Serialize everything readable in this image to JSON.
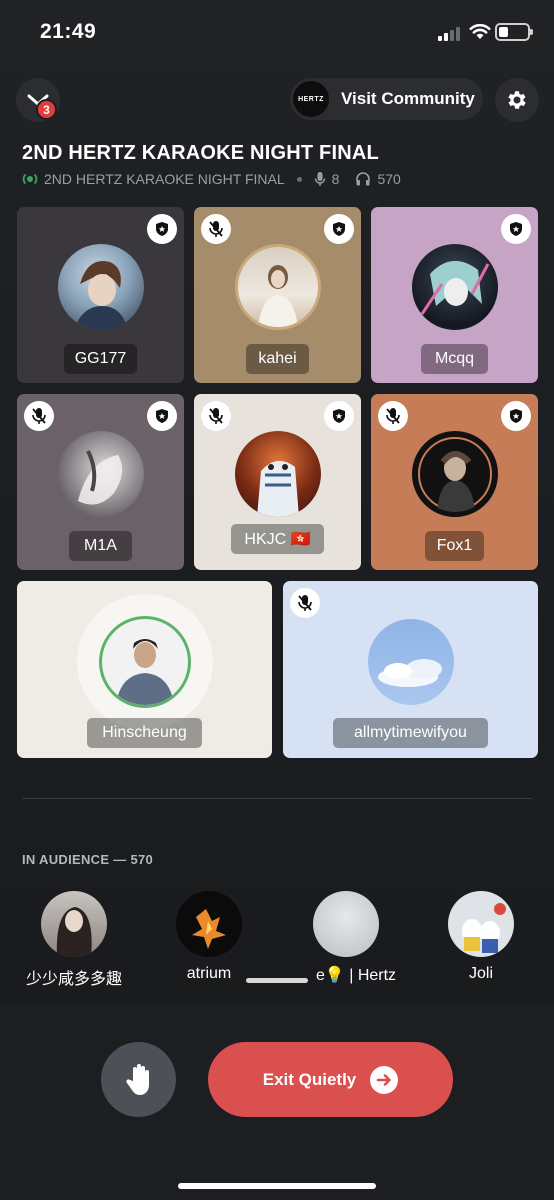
{
  "status_bar": {
    "time": "21:49"
  },
  "header": {
    "notification_count": "3",
    "visit_logo_text": "HERTZ",
    "visit_label": "Visit Community"
  },
  "stage": {
    "title": "2ND HERTZ KARAOKE NIGHT FINAL",
    "subtitle": "2ND HERTZ KARAOKE NIGHT FINAL",
    "speakers_count": "8",
    "listeners_count": "570"
  },
  "speakers": [
    {
      "name": "GG177",
      "muted": false,
      "moderator": true,
      "tile_color": "#3b383d"
    },
    {
      "name": "kahei",
      "muted": true,
      "moderator": true,
      "tile_color": "#a58c6b"
    },
    {
      "name": "Mcqq",
      "muted": false,
      "moderator": true,
      "tile_color": "#c6a4c6"
    },
    {
      "name": "M1A",
      "muted": true,
      "moderator": true,
      "tile_color": "#6b6169"
    },
    {
      "name": "HKJC 🇭🇰",
      "muted": true,
      "moderator": true,
      "tile_color": "#e7e3dc"
    },
    {
      "name": "Fox1",
      "muted": true,
      "moderator": true,
      "tile_color": "#c67d57"
    },
    {
      "name": "Hinscheung",
      "muted": false,
      "moderator": false,
      "speaking": true,
      "tile_color": "#efebe5"
    },
    {
      "name": "allmytimewifyou",
      "muted": true,
      "moderator": false,
      "tile_color": "#d6e2f4"
    }
  ],
  "audience": {
    "heading": "IN AUDIENCE — 570",
    "members": [
      {
        "name": "少少咸多多趣"
      },
      {
        "name": "atrium"
      },
      {
        "name": "e💡 | Hertz"
      },
      {
        "name": "Joli"
      }
    ]
  },
  "actions": {
    "exit_label": "Exit Quietly"
  },
  "colors": {
    "background": "#1a1c1f",
    "exit_button": "#d9504e",
    "speaking_ring": "#5bb36a",
    "badge": "#e03e3e"
  }
}
